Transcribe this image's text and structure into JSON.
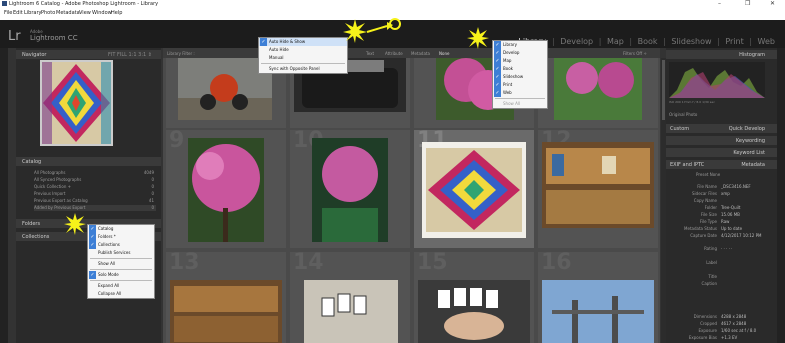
{
  "window": {
    "title": "Lightroom 6 Catalog - Adobe Photoshop Lightroom - Library",
    "controls": [
      "–",
      "❐",
      "✕"
    ]
  },
  "menubar": [
    "File",
    "Edit",
    "Library",
    "Photo",
    "Metadata",
    "View",
    "Window",
    "Help"
  ],
  "identity": {
    "logo": "Lr",
    "brand_small": "Adobe",
    "product": "Lightroom CC"
  },
  "modules": {
    "items": [
      "Library",
      "Develop",
      "Map",
      "Book",
      "Slideshow",
      "Print",
      "Web"
    ],
    "active": "Library",
    "separator": "|"
  },
  "left_panel": {
    "navigator": {
      "title": "Navigator",
      "zoom": "FIT  FILL  1:1  3:1 ⇕"
    },
    "catalog": {
      "title": "Catalog",
      "rows": [
        {
          "label": "All Photographs",
          "count": "4049"
        },
        {
          "label": "All Synced Photographs",
          "count": "0"
        },
        {
          "label": "Quick Collection +",
          "count": "0"
        },
        {
          "label": "Previous Import",
          "count": "0"
        },
        {
          "label": "Previous Export as Catalog",
          "count": "41"
        },
        {
          "label": "Added by Previous Export",
          "count": "0"
        }
      ]
    },
    "folders": {
      "title": "Folders"
    },
    "collections": {
      "title": "Collections"
    }
  },
  "filter_bar": {
    "title": "Library Filter :",
    "options": [
      "Text",
      "Attribute",
      "Metadata",
      "None"
    ],
    "right": "Filters Off ÷"
  },
  "grid_numbers": [
    "9",
    "10",
    "11",
    "12",
    "13",
    "14",
    "15",
    "16"
  ],
  "right_panel": {
    "histogram": {
      "title": "Histogram",
      "readout": "ISO 200    17mm    f / 8.0    1/30 sec",
      "photo_label": "Original Photo"
    },
    "quick_develop": {
      "preset": "Custom",
      "title": "Quick Develop"
    },
    "keywording": {
      "title": "Keywording"
    },
    "keyword_list": {
      "title": "Keyword List"
    },
    "metadata": {
      "preset_label": "EXIF and IPTC",
      "title": "Metadata",
      "preset_row": "Preset  None",
      "rows": [
        {
          "k": "File Name",
          "v": "_DSC3416.NEF"
        },
        {
          "k": "Sidecar Files",
          "v": "xmp"
        },
        {
          "k": "Copy Name",
          "v": ""
        },
        {
          "k": "Folder",
          "v": "Tree-Quilt"
        },
        {
          "k": "File Size",
          "v": "15.06 MB"
        },
        {
          "k": "File Type",
          "v": "Raw"
        },
        {
          "k": "Metadata Status",
          "v": "Up to date"
        },
        {
          "k": "Capture Date",
          "v": "4/12/2017 10:12 PM"
        },
        {
          "k": "Rating",
          "v": "· · · · ·"
        },
        {
          "k": "Label",
          "v": ""
        },
        {
          "k": "Title",
          "v": ""
        },
        {
          "k": "Caption",
          "v": ""
        },
        {
          "k": "Dimensions",
          "v": "4288 x 2848"
        },
        {
          "k": "Cropped",
          "v": "4617 x 2848"
        },
        {
          "k": "Exposure",
          "v": "1/60 sec at f / 8.0"
        },
        {
          "k": "Exposure Bias",
          "v": "+1.3 EV"
        }
      ]
    }
  },
  "menus": {
    "panel_menu": {
      "items": [
        {
          "label": "Auto Hide & Show",
          "checked": true
        },
        {
          "label": "Auto Hide",
          "checked": false
        },
        {
          "label": "Manual",
          "checked": false
        },
        {
          "label": "Sync with Opposite Panel",
          "checked": false
        }
      ]
    },
    "module_menu": {
      "items": [
        {
          "label": "Library",
          "checked": true
        },
        {
          "label": "Develop",
          "checked": true
        },
        {
          "label": "Map",
          "checked": true
        },
        {
          "label": "Book",
          "checked": true
        },
        {
          "label": "Slideshow",
          "checked": true
        },
        {
          "label": "Print",
          "checked": true
        },
        {
          "label": "Web",
          "checked": true
        },
        {
          "label": "Show All",
          "checked": false
        }
      ]
    },
    "left_panel_menu": {
      "items": [
        {
          "label": "Catalog",
          "checked": true
        },
        {
          "label": "Folders *",
          "checked": true
        },
        {
          "label": "Collections",
          "checked": true
        },
        {
          "label": "Publish Services",
          "checked": false
        },
        {
          "label": "Show All",
          "checked": false
        },
        {
          "label": "Solo Mode",
          "checked": true
        },
        {
          "label": "Expand All",
          "checked": false
        },
        {
          "label": "Collapse All",
          "checked": false
        }
      ]
    }
  },
  "colors": {
    "accent": "#3d7fd6",
    "burst": "#f6f21a",
    "bg_dark": "#333333"
  }
}
